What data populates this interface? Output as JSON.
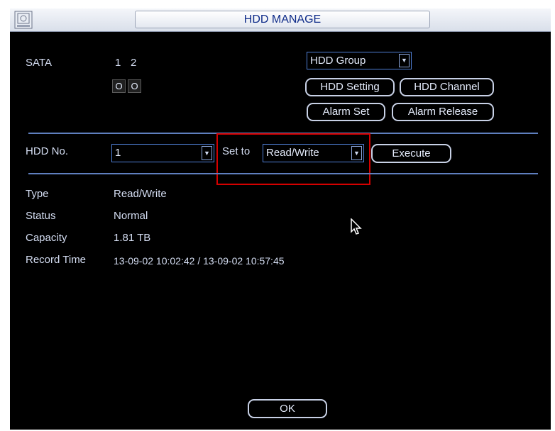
{
  "window": {
    "title": "HDD MANAGE"
  },
  "sata": {
    "label": "SATA",
    "ports": [
      {
        "number": "1",
        "checkbox": "O"
      },
      {
        "number": "2",
        "checkbox": "O"
      }
    ]
  },
  "hdd_group_select": {
    "value": "HDD Group"
  },
  "buttons": {
    "hdd_setting": "HDD Setting",
    "hdd_channel": "HDD Channel",
    "alarm_set": "Alarm Set",
    "alarm_release": "Alarm Release",
    "execute": "Execute",
    "ok": "OK"
  },
  "hdd_no": {
    "label": "HDD No.",
    "value": "1"
  },
  "set_to": {
    "label": "Set to",
    "value": "Read/Write"
  },
  "info": {
    "type_label": "Type",
    "type_value": "Read/Write",
    "status_label": "Status",
    "status_value": "Normal",
    "capacity_label": "Capacity",
    "capacity_value": "1.81 TB",
    "record_time_label": "Record Time",
    "record_time_value": "13-09-02 10:02:42 / 13-09-02 10:57:45"
  },
  "icons": {
    "title": "hdd-icon",
    "dropdown": "chevron-down-icon",
    "pointer": "cursor-arrow-icon"
  },
  "colors": {
    "background": "#000000",
    "text": "#d4ddf2",
    "title_text": "#0d2a88",
    "divider": "#5f7fbf",
    "highlight": "#d40000"
  }
}
